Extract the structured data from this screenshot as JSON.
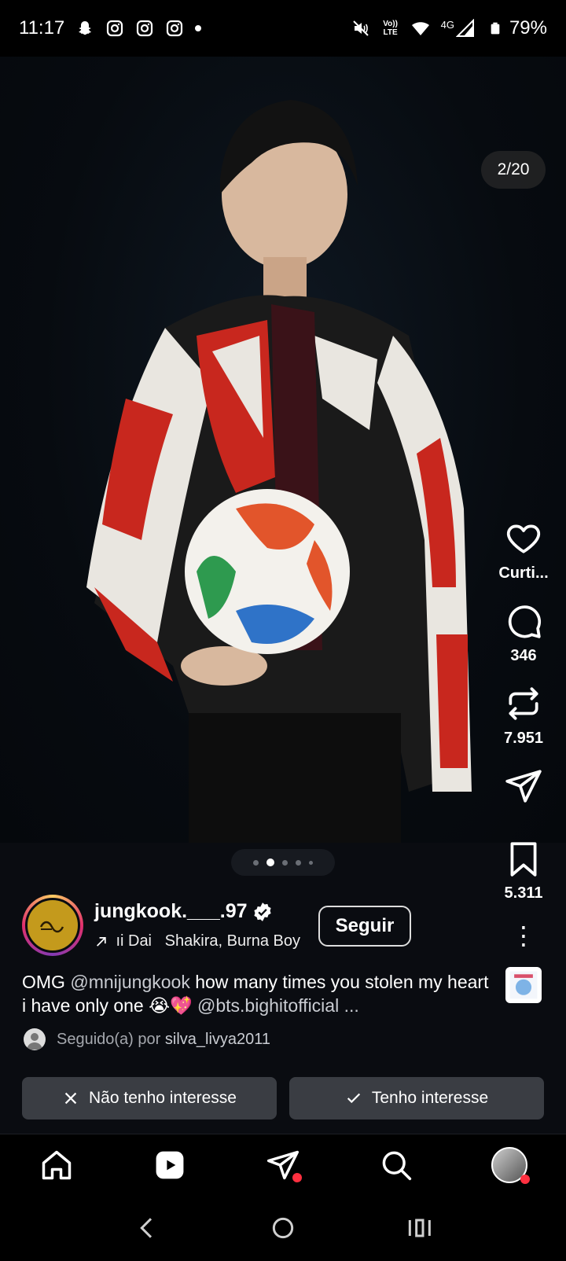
{
  "status_bar": {
    "time": "11:17",
    "battery": "79%",
    "network_label": "4G",
    "volte_label": "Vo)) LTE"
  },
  "post": {
    "image_counter": "2/20",
    "pager": {
      "count": 5,
      "active_index": 1
    }
  },
  "actions": {
    "like_label": "Curti...",
    "comments": "346",
    "reposts": "7.951",
    "saves": "5.311"
  },
  "account": {
    "username": "jungkook.___.97",
    "follow_label": "Seguir",
    "audio_text": "ıi Dai   Shakira, Burna Boy"
  },
  "caption": {
    "text1": "OMG ",
    "mention1": "@mnijungkook",
    "text2": " how many times you stolen my heart i have only one 😭💖 ",
    "mention2": "@bts.bighitofficial",
    "ellipsis": " ..."
  },
  "followed_by": {
    "prefix": "Seguido(a) por ",
    "user": "silva_livya2011"
  },
  "interest": {
    "not_interested": "Não tenho interesse",
    "interested": "Tenho interesse"
  },
  "colors": {
    "background": "#000000",
    "info_bg": "#0a0c11",
    "button_bg": "#3a3d43",
    "badge": "#ff3040"
  }
}
